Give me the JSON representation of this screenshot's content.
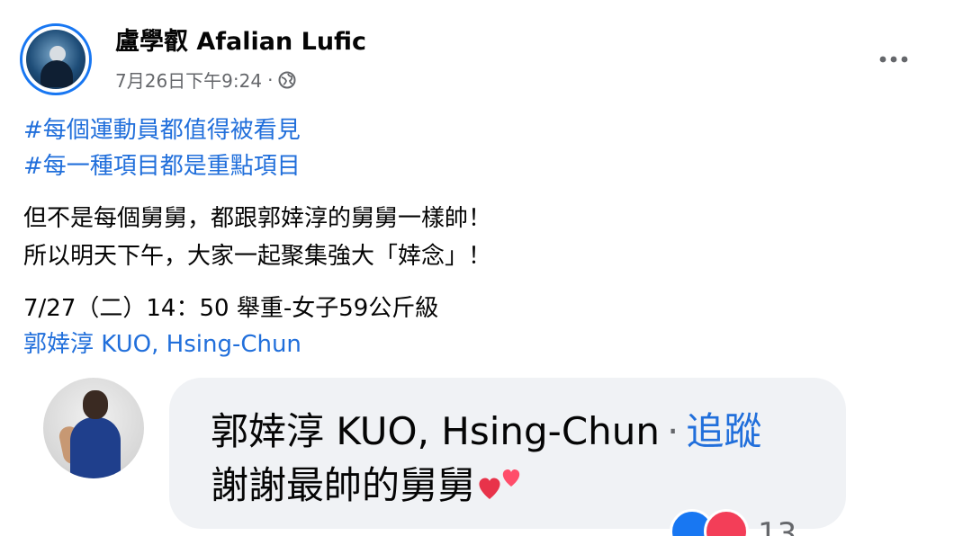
{
  "post": {
    "author": "盧學叡 Afalian Lufic",
    "timestamp": "7月26日下午9:24",
    "meta_separator": "·",
    "privacy_icon": "globe-icon",
    "more_icon": "more-options-icon",
    "hashtags": [
      "#每個運動員都值得被看見",
      "#每一種項目都是重點項目"
    ],
    "body_lines": [
      "但不是每個舅舅，都跟郭婞淳的舅舅一樣帥！",
      "所以明天下午，大家一起聚集強大「婞念」！"
    ],
    "event_line": "7/27（二）14：50 舉重-女子59公斤級",
    "mention": "郭婞淳 KUO, Hsing-Chun"
  },
  "comment": {
    "author": "郭婞淳 KUO, Hsing-Chun",
    "separator": "·",
    "follow_label": "追蹤",
    "text": "謝謝最帥的舅舅",
    "emoji": "two-hearts-icon",
    "reaction_icons": [
      "like-icon",
      "love-icon"
    ],
    "reaction_count": "13"
  },
  "colors": {
    "link_blue": "#216fdb",
    "bubble_gray": "#f0f2f5",
    "meta_gray": "#65676b",
    "like_blue": "#1877f2",
    "love_red": "#f33e58"
  }
}
